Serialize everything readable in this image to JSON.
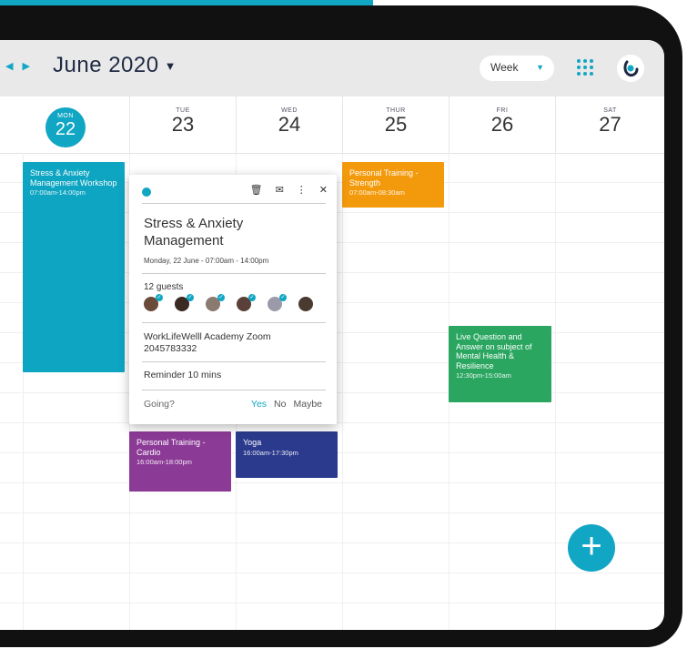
{
  "header": {
    "month": "June 2020",
    "view": "Week"
  },
  "days": [
    {
      "name": "MON",
      "num": "22",
      "today": true
    },
    {
      "name": "TUE",
      "num": "23"
    },
    {
      "name": "WED",
      "num": "24"
    },
    {
      "name": "THUR",
      "num": "25"
    },
    {
      "name": "FRI",
      "num": "26"
    },
    {
      "name": "SAT",
      "num": "27"
    }
  ],
  "events": [
    {
      "title": "Stress & Anxiety Management Workshop",
      "time": "07:00am-14:00pm",
      "color": "#0ea5c2"
    },
    {
      "title": "Personal Training - Strength",
      "time": "07:00am-08:30am",
      "color": "#f39a0c"
    },
    {
      "title": "Live Question and Answer on subject of Mental Health & Resilience",
      "time": "12:30pm-15:00am",
      "color": "#2aa660"
    },
    {
      "title": "Personal Training - Cardio",
      "time": "16:00am-18:00pm",
      "color": "#8b3a96"
    },
    {
      "title": "Yoga",
      "time": "16:00am-17:30pm",
      "color": "#2b3a8c"
    }
  ],
  "popup": {
    "title": "Stress & Anxiety Management",
    "date": "Monday, 22 June  -  07:00am - 14:00pm",
    "guests": "12 guests",
    "location": "WorkLifeWelll Academy Zoom 2045783332",
    "reminder": "Reminder 10 mins",
    "going": "Going?",
    "yes": "Yes",
    "no": "No",
    "maybe": "Maybe"
  },
  "colors": {
    "accent": "#11a6c4"
  }
}
